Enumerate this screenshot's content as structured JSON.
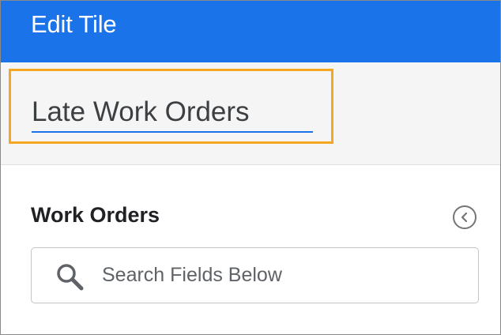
{
  "header": {
    "title": "Edit Tile"
  },
  "tile": {
    "title_value": "Late Work Orders"
  },
  "section": {
    "title": "Work Orders",
    "collapse_icon": "chevron-left-circle-icon"
  },
  "search": {
    "placeholder": "Search Fields Below",
    "icon": "search-icon"
  },
  "colors": {
    "header_bg": "#1a73e8",
    "highlight_border": "#f5a623",
    "input_underline": "#1a73e8"
  }
}
